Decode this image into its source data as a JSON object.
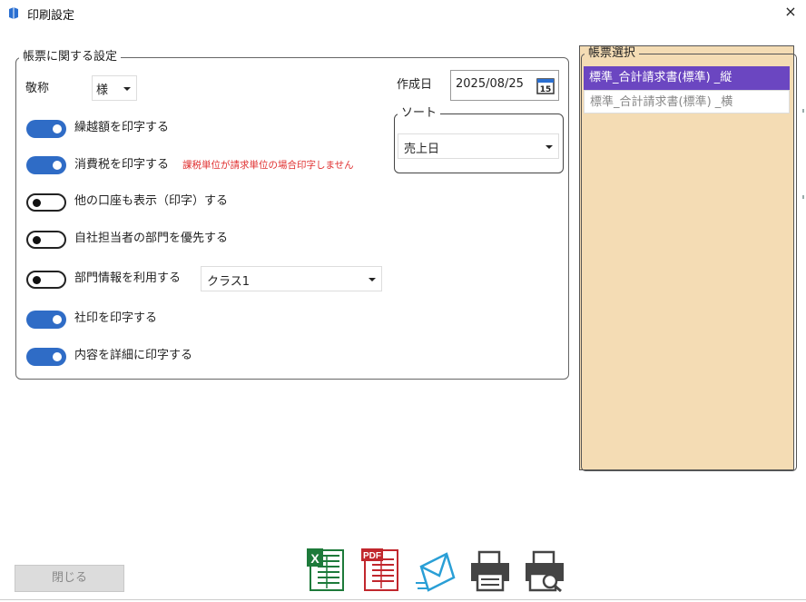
{
  "window": {
    "title": "印刷設定",
    "close_glyph": "×"
  },
  "form_settings": {
    "legend": "帳票に関する設定",
    "honorific": {
      "label": "敬称",
      "value": "様"
    },
    "created_date": {
      "label": "作成日",
      "value": "2025/08/25",
      "calendar_day": "15"
    },
    "sort": {
      "legend": "ソート",
      "value": "売上日"
    },
    "toggles": [
      {
        "label": "繰越額を印字する",
        "on": true
      },
      {
        "label": "消費税を印字する",
        "on": true,
        "note": "課税単位が請求単位の場合印字しません"
      },
      {
        "label": "他の口座も表示（印字）する",
        "on": false
      },
      {
        "label": "自社担当者の部門を優先する",
        "on": false
      },
      {
        "label": "部門情報を利用する",
        "on": false
      },
      {
        "label": "社印を印字する",
        "on": true
      },
      {
        "label": "内容を詳細に印字する",
        "on": true
      }
    ],
    "department_select": {
      "value": "クラス1"
    }
  },
  "form_selection": {
    "legend": "帳票選択",
    "items": [
      {
        "label": "標準_合計請求書(標準) _縦",
        "selected": true
      },
      {
        "label": "標準_合計請求書(標準) _横",
        "selected": false
      }
    ]
  },
  "footer": {
    "close_label": "閉じる",
    "tools": [
      "excel-export-icon",
      "pdf-export-icon",
      "email-send-icon",
      "print-icon",
      "print-preview-icon"
    ],
    "excel_letter": "X",
    "pdf_letters": "PDF"
  },
  "colors": {
    "toggle_on": "#2f6cc6",
    "selected_item": "#6b46c1",
    "side_panel": "#f4dcb4",
    "warning": "#e03030"
  }
}
